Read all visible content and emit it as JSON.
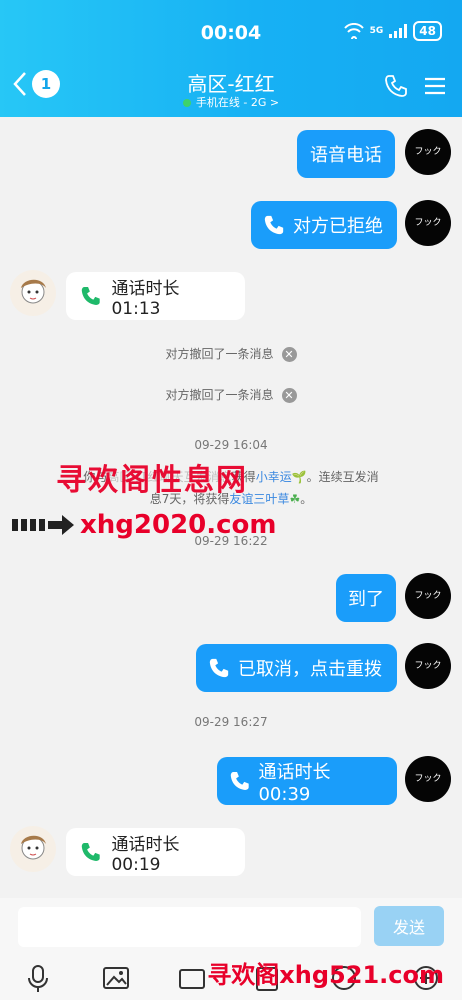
{
  "status": {
    "time": "00:04",
    "network": "5G",
    "battery": "48"
  },
  "header": {
    "back_count": "1",
    "title": "高区-红红",
    "subtitle": "手机在线 - 2G >"
  },
  "messages": {
    "m1": "语音电话",
    "m2": "对方已拒绝",
    "m3": "通话时长 01:13",
    "recall1": "对方撤回了一条消息",
    "recall2": "对方撤回了一条消息",
    "time1": "09-29 16:04",
    "system_line1": "你与",
    "system_hidden": "高区-红红聊天互发消息",
    "system_line1_mid": "获得",
    "lucky": "小幸运",
    "system_line1_end": "。连续互发消",
    "system_line2_a": "息7天，将获得",
    "friendship": "友谊三叶草",
    "system_line2_end": "。",
    "time2": "09-29 16:22",
    "m4": "到了",
    "m5": "已取消，点击重拨",
    "time3": "09-29 16:27",
    "m6": "通话时长 00:39",
    "m7": "通话时长 00:19"
  },
  "avatar_text": "フック",
  "watermarks": {
    "cn": "寻欢阁性息网",
    "url": "xhg2020.com",
    "bottom": "寻欢阁xhg521.com"
  },
  "input": {
    "send_label": "发送"
  },
  "colors": {
    "accent": "#1a9dfa",
    "header": "#17b1f4",
    "call_green": "#1fb96a"
  }
}
